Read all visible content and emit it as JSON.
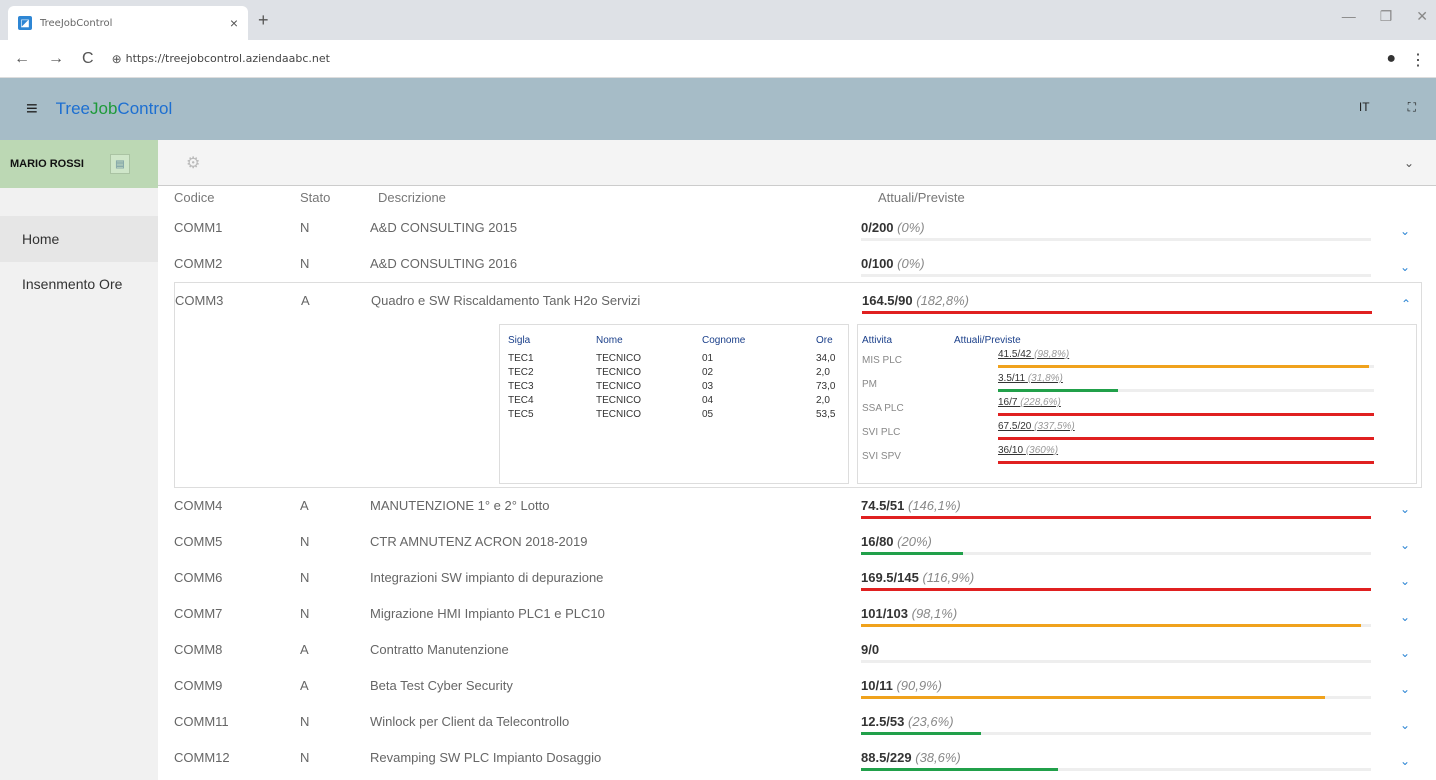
{
  "browser": {
    "tab_title": "TreeJobControl",
    "url": "https://treejobcontrol.aziendaabc.net"
  },
  "app": {
    "brand_a": "Tree",
    "brand_b": "Job",
    "brand_c": "Control",
    "lang": "IT"
  },
  "sidebar": {
    "user": "MARIO ROSSI",
    "items": [
      {
        "label": "Home"
      },
      {
        "label": "Insenmento Ore"
      }
    ]
  },
  "table": {
    "headers": {
      "code": "Codice",
      "stato": "Stato",
      "desc": "Descrizione",
      "act": "Attuali/Previste"
    },
    "rows": [
      {
        "code": "COMM1",
        "stato": "N",
        "desc": "A&D CONSULTING  2015",
        "act": "0/200",
        "pct": "(0%)",
        "fill": 0,
        "color": "#e02020"
      },
      {
        "code": "COMM2",
        "stato": "N",
        "desc": "A&D CONSULTING 2016",
        "act": "0/100",
        "pct": "(0%)",
        "fill": 0,
        "color": "#e02020"
      },
      {
        "code": "COMM3",
        "stato": "A",
        "desc": "Quadro e SW Riscaldamento Tank H2o Servizi",
        "act": "164.5/90",
        "pct": "(182,8%)",
        "fill": 1,
        "color": "#e02020"
      },
      {
        "code": "COMM4",
        "stato": "A",
        "desc": "MANUTENZIONE 1° e 2° Lotto",
        "act": "74.5/51",
        "pct": "(146,1%)",
        "fill": 1,
        "color": "#e02020"
      },
      {
        "code": "COMM5",
        "stato": "N",
        "desc": "CTR AMNUTENZ ACRON 2018-2019",
        "act": "16/80",
        "pct": "(20%)",
        "fill": 0.2,
        "color": "#21a04a"
      },
      {
        "code": "COMM6",
        "stato": "N",
        "desc": "Integrazioni SW impianto di depurazione",
        "act": "169.5/145",
        "pct": "(116,9%)",
        "fill": 1,
        "color": "#e02020"
      },
      {
        "code": "COMM7",
        "stato": "N",
        "desc": "Migrazione HMI Impianto PLC1 e PLC10",
        "act": "101/103",
        "pct": "(98,1%)",
        "fill": 0.981,
        "color": "#f0a21c"
      },
      {
        "code": "COMM8",
        "stato": "A",
        "desc": "Contratto Manutenzione",
        "act": "9/0",
        "pct": "",
        "fill": 0,
        "color": "#e02020"
      },
      {
        "code": "COMM9",
        "stato": "A",
        "desc": "Beta Test Cyber Security",
        "act": "10/11",
        "pct": "(90,9%)",
        "fill": 0.909,
        "color": "#f0a21c"
      },
      {
        "code": "COMM11",
        "stato": "N",
        "desc": "Winlock per Client da Telecontrollo",
        "act": "12.5/53",
        "pct": "(23,6%)",
        "fill": 0.236,
        "color": "#21a04a"
      },
      {
        "code": "COMM12",
        "stato": "N",
        "desc": "Revamping SW PLC Impianto Dosaggio",
        "act": "88.5/229",
        "pct": "(38,6%)",
        "fill": 0.386,
        "color": "#21a04a"
      }
    ]
  },
  "detail": {
    "tech_headers": {
      "sigla": "Sigla",
      "nome": "Nome",
      "cognome": "Cognome",
      "ore": "Ore"
    },
    "techs": [
      {
        "sigla": "TEC1",
        "nome": "TECNICO",
        "cognome": "01",
        "ore": "34,0"
      },
      {
        "sigla": "TEC2",
        "nome": "TECNICO",
        "cognome": "02",
        "ore": "2,0"
      },
      {
        "sigla": "TEC3",
        "nome": "TECNICO",
        "cognome": "03",
        "ore": "73,0"
      },
      {
        "sigla": "TEC4",
        "nome": "TECNICO",
        "cognome": "04",
        "ore": "2,0"
      },
      {
        "sigla": "TEC5",
        "nome": "TECNICO",
        "cognome": "05",
        "ore": "53,5"
      }
    ],
    "act_headers": {
      "attivita": "Attivita",
      "act": "Attuali/Previste"
    },
    "activities": [
      {
        "name": "MIS PLC",
        "act": "41.5/42",
        "pct": "(98,8%)",
        "fill": 0.988,
        "color": "#f0a21c"
      },
      {
        "name": "PM",
        "act": "3.5/11",
        "pct": "(31,8%)",
        "fill": 0.318,
        "color": "#21a04a"
      },
      {
        "name": "SSA PLC",
        "act": "16/7",
        "pct": "(228,6%)",
        "fill": 1,
        "color": "#e02020"
      },
      {
        "name": "SVI PLC",
        "act": "67.5/20",
        "pct": "(337,5%)",
        "fill": 1,
        "color": "#e02020"
      },
      {
        "name": "SVI SPV",
        "act": "36/10",
        "pct": "(360%)",
        "fill": 1,
        "color": "#e02020"
      }
    ]
  }
}
